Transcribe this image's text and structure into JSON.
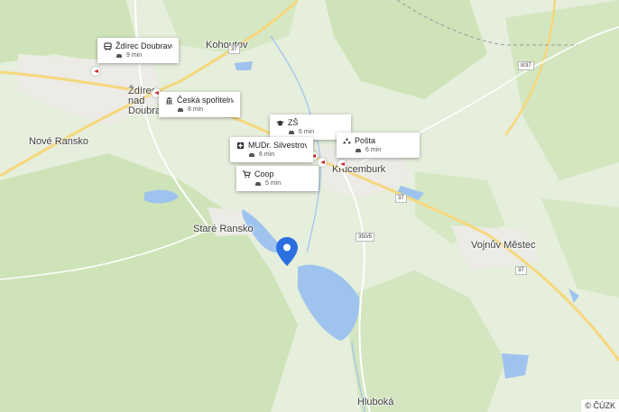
{
  "places": {
    "kohoutov": "Kohoutov",
    "zdirec": "Ždírec nad Doubravou",
    "nove_ransko": "Nové Ransko",
    "krucemburk": "Krucemburk",
    "stare_ransko": "Staré Ransko",
    "vojnuv_mestec": "Vojnův Městec",
    "hluboka": "Hluboká"
  },
  "road_shields": {
    "r1": "37",
    "r2": "II/37",
    "r3": "350/5",
    "r4": "37",
    "r5": "37"
  },
  "pois": [
    {
      "icon": "bus-icon",
      "label": "Ždírec Doubravou",
      "time": "9 min"
    },
    {
      "icon": "bank-icon",
      "label": "Česká spořitelna",
      "time": "8 min"
    },
    {
      "icon": "school-icon",
      "label": "ZŠ",
      "time": "6 min"
    },
    {
      "icon": "medical-icon",
      "label": "MUDr. Silvestrová...",
      "time": "6 min"
    },
    {
      "icon": "post-icon",
      "label": "Pošta",
      "time": "6 min"
    },
    {
      "icon": "shop-icon",
      "label": "Coop",
      "time": "5 min"
    }
  ],
  "colors": {
    "forest": "#cfe3b9",
    "field": "#e8efe0",
    "water": "#9ec3ee",
    "road_main": "#f6d77c",
    "road_minor": "#ffffff",
    "pin": "#2b6fe0"
  },
  "copyright": "© ČÚZK"
}
